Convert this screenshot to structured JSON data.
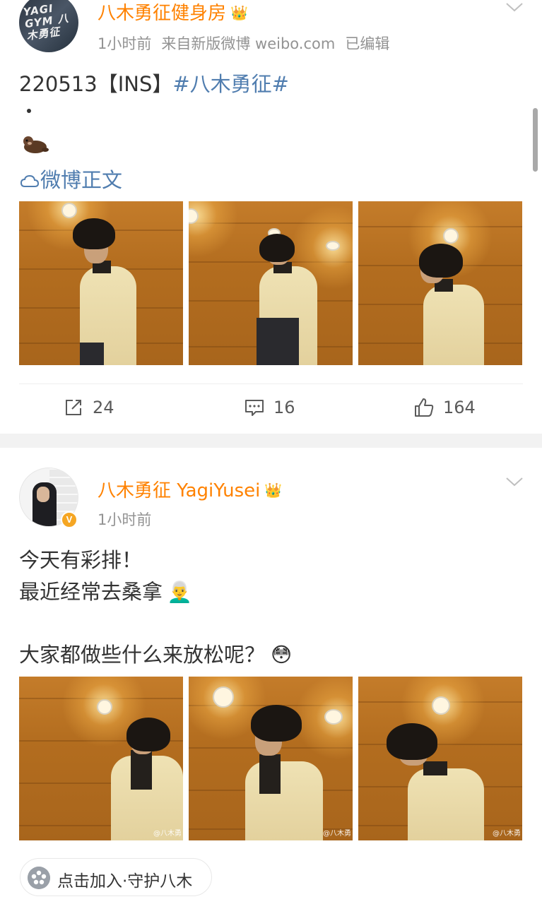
{
  "post1": {
    "username": "八木勇征健身房",
    "crown": "👑",
    "avatar_text": "YAGI GYM 八木勇征",
    "time": "1小时前",
    "source": "来自新版微博 weibo.com",
    "edited": "已编辑",
    "text_prefix": "220513【INS】",
    "topic": "#八木勇征#",
    "dot": "·",
    "emoji": "otter",
    "link": "微博正文",
    "images": [
      "photo-1",
      "photo-2",
      "photo-3"
    ],
    "reposts": "24",
    "comments": "16",
    "likes": "164"
  },
  "post2": {
    "username": "八木勇征 YagiYusei",
    "crown": "👑",
    "verified": "V",
    "time": "1小时前",
    "line1": "今天有彩排！",
    "line2": "最近经常去桑拿",
    "line2_emoji": "👨‍🦳",
    "line3": "大家都做些什么来放松呢？",
    "line3_emoji": "😳",
    "watermarks": [
      "@八木勇",
      "@八木勇",
      "@八木勇"
    ],
    "fan_chip": "点击加入·守护八木"
  },
  "icons": {
    "repost": "repost-icon",
    "comment": "comment-icon",
    "like": "like-icon",
    "chevron": "chevron-down-icon",
    "link": "weibo-link-icon",
    "fan": "fan-group-icon"
  },
  "colors": {
    "username": "#ff8200",
    "link": "#507daf",
    "meta": "#939393",
    "separator": "#f2f2f2"
  }
}
